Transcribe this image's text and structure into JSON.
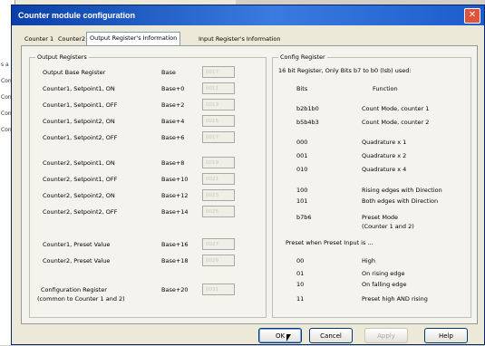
{
  "dialog": {
    "title": "Counter module configuration",
    "close_glyph": "✕"
  },
  "background_window": {
    "strip_texts": [
      "s a",
      "Con",
      "Con",
      "Con",
      "Con"
    ]
  },
  "tabs": [
    {
      "label": "Counter 1",
      "active": false
    },
    {
      "label": "Counter2",
      "active": false
    },
    {
      "label": "Output Register's Information",
      "active": true
    },
    {
      "label": "Input Register's Information",
      "active": false
    }
  ],
  "output_registers": {
    "title": "Output Registers",
    "rows": [
      {
        "label": "Output Base Register",
        "base": "Base",
        "value": "0017"
      },
      {
        "label": "Counter1, Setpoint1, ON",
        "base": "Base+0",
        "value": "0011"
      },
      {
        "label": "Counter1, Setpoint1, OFF",
        "base": "Base+2",
        "value": "0013"
      },
      {
        "label": "Counter1, Setpoint2, ON",
        "base": "Base+4",
        "value": "0015"
      },
      {
        "label": "Counter1, Setpoint2, OFF",
        "base": "Base+6",
        "value": "0017"
      },
      {
        "label": "Counter2, Setpoint1, ON",
        "base": "Base+8",
        "value": "0019"
      },
      {
        "label": "Counter2, Setpoint1, OFF",
        "base": "Base+10",
        "value": "0021"
      },
      {
        "label": "Counter2, Setpoint2, ON",
        "base": "Base+12",
        "value": "0023"
      },
      {
        "label": "Counter2, Setpoint2, OFF",
        "base": "Base+14",
        "value": "0025"
      },
      {
        "label": "Counter1, Preset Value",
        "base": "Base+16",
        "value": "0027"
      },
      {
        "label": "Counter2, Preset Value",
        "base": "Base+18",
        "value": "0029"
      },
      {
        "label": "Configuration Register",
        "label2": "(common to Counter 1 and 2)",
        "base": "Base+20",
        "value": "0031"
      }
    ]
  },
  "config_register": {
    "title": "Config Register",
    "description": "16 bit Register, Only Bits b7 to b0 (lsb) used:",
    "col_bits": "Bits",
    "col_function": "Function",
    "entries": [
      {
        "bits": "b2b1b0",
        "function": "Count Mode, counter 1"
      },
      {
        "bits": "b5b4b3",
        "function": "Count Mode, counter 2"
      },
      {
        "bits": "000",
        "function": "Quadrature x 1"
      },
      {
        "bits": "001",
        "function": "Quadrature x 2"
      },
      {
        "bits": "010",
        "function": "Quadrature x 4"
      },
      {
        "bits": "100",
        "function": "Rising edges with Direction"
      },
      {
        "bits": "101",
        "function": "Both edges with Direction"
      },
      {
        "bits": "b7b6",
        "function": "Preset Mode",
        "function2": "(Counter 1 and 2)"
      }
    ],
    "preset_heading": "Preset when Preset Input is ...",
    "preset_entries": [
      {
        "bits": "00",
        "function": "High"
      },
      {
        "bits": "01",
        "function": "On rising edge"
      },
      {
        "bits": "10",
        "function": "On falling edge"
      },
      {
        "bits": "11",
        "function": "Preset high AND rising"
      }
    ]
  },
  "buttons": {
    "ok": "OK",
    "cancel": "Cancel",
    "apply": "Apply",
    "help": "Help"
  }
}
